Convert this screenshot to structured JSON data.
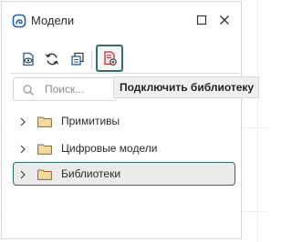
{
  "window": {
    "title": "Модели",
    "app_icon": "models-app-icon",
    "controls": {
      "maximize_icon": "maximize-icon",
      "close_icon": "close-icon"
    }
  },
  "toolbar": {
    "buttons": [
      {
        "icon": "view-document-icon",
        "active": false
      },
      {
        "icon": "refresh-icon",
        "active": false
      },
      {
        "icon": "copy-windows-icon",
        "active": false
      },
      {
        "icon": "connect-library-icon",
        "active": true
      }
    ]
  },
  "search": {
    "placeholder": "Поиск...",
    "value": "",
    "icon": "search-icon"
  },
  "tooltip": {
    "text": "Подключить библиотеку"
  },
  "tree": {
    "items": [
      {
        "label": "Примитивы",
        "icon": "folder-icon",
        "expanded": false,
        "selected": false
      },
      {
        "label": "Цифровые модели",
        "icon": "folder-icon",
        "expanded": false,
        "selected": false
      },
      {
        "label": "Библиотеки",
        "icon": "folder-icon",
        "expanded": false,
        "selected": true
      }
    ]
  },
  "colors": {
    "accent": "#2e6f6a",
    "library_icon": "#b23b3b",
    "folder_fill": "#f3d9a4",
    "folder_stroke": "#8a6a30",
    "toolbar_icon": "#1f5fa8"
  }
}
